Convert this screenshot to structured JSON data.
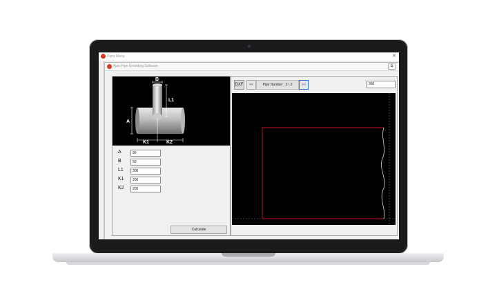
{
  "back_window": {
    "title": "Parts Menu"
  },
  "front_window": {
    "title": "Ajan Pipe Unfolding Software",
    "restore_symbol": "⧉"
  },
  "diagram": {
    "labels": {
      "b": "B",
      "l1": "L1",
      "a": "A",
      "k1": "K1",
      "k2": "K2"
    }
  },
  "fields": [
    {
      "label": "A",
      "value": "90"
    },
    {
      "label": "B",
      "value": "50"
    },
    {
      "label": "L1",
      "value": "300"
    },
    {
      "label": "K1",
      "value": "200"
    },
    {
      "label": "K2",
      "value": "200"
    }
  ],
  "buttons": {
    "calculate": "Calculate"
  },
  "toolbar": {
    "dxf": "DXF",
    "prev": "<<",
    "pipe_number": "Pipe Number : 2 \\ 2",
    "next": ">>",
    "degrees": "360"
  },
  "colors": {
    "app_icon": "#d23a2a",
    "outline": "#c8102e",
    "next_highlight": "#2a72c8"
  }
}
